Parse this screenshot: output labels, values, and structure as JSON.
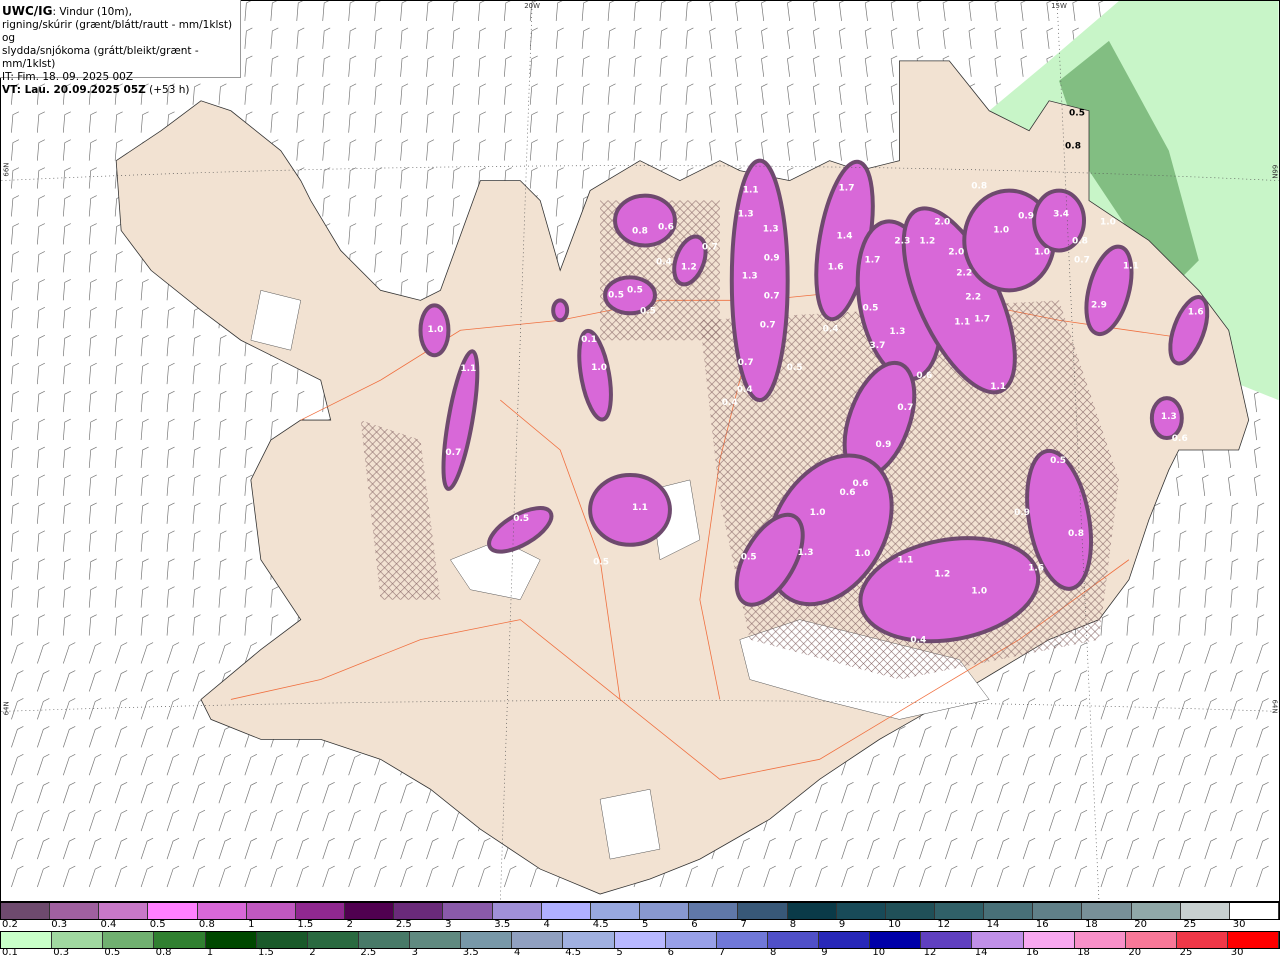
{
  "header": {
    "model": "UWC/IG",
    "line1_rest": ": Vindur (10m),",
    "line2": "rigning/skúrir (grænt/blátt/rautt - mm/1klst) og",
    "line3": "slydda/snjókoma (grátt/bleikt/grænt - mm/1klst)",
    "init_time": "IT: Fim. 18. 09. 2025 00Z",
    "valid_label": "VT: Lau. 20.09.2025 05Z",
    "lead": " (+53 h)"
  },
  "grid_labels": {
    "lon_20w": "20W",
    "lon_15w": "15W",
    "lat_66n_left": "66N",
    "lat_66n_right": "66N",
    "lat_64n_left": "64N",
    "lat_64n_right": "64N"
  },
  "precip_values": [
    "1.0",
    "1.1",
    "0.7",
    "0.5",
    "1.1",
    "0.5",
    "0.1",
    "1.0",
    "0.5",
    "0.5",
    "0.5",
    "0.8",
    "0.6",
    "0.4",
    "1.2",
    "0.7",
    "1.1",
    "1.3",
    "1.3",
    "0.9",
    "1.3",
    "0.7",
    "0.7",
    "0.7",
    "0.4",
    "0.4",
    "0.5",
    "1.7",
    "1.4",
    "1.6",
    "1.7",
    "2.3",
    "1.2",
    "2.0",
    "2.0",
    "2.2",
    "2.2",
    "1.1",
    "1.7",
    "0.4",
    "0.5",
    "1.3",
    "3.7",
    "0.6",
    "0.7",
    "0.9",
    "0.6",
    "0.6",
    "1.0",
    "1.3",
    "1.0",
    "1.1",
    "1.2",
    "1.0",
    "0.4",
    "1.6",
    "0.9",
    "0.5",
    "0.8",
    "0.8",
    "0.9",
    "1.0",
    "1.0",
    "3.4",
    "1.0",
    "0.8",
    "0.7",
    "1.1",
    "2.9",
    "1.6",
    "1.3",
    "0.6",
    "0.5",
    "0.8",
    "0.5",
    "1.1"
  ],
  "snow_scale": {
    "labels": [
      "0.2",
      "0.3",
      "0.4",
      "0.5",
      "0.8",
      "1",
      "1.5",
      "2",
      "2.5",
      "3",
      "3.5",
      "4",
      "4.5",
      "5",
      "6",
      "7",
      "8",
      "9",
      "10",
      "12",
      "14",
      "16",
      "18",
      "20",
      "25",
      "30"
    ],
    "colors": [
      "#6e4a6e",
      "#a060a0",
      "#c878c8",
      "#ff80ff",
      "#d868d8",
      "#c058c0",
      "#902890",
      "#500050",
      "#6a2a7a",
      "#8a5aaa",
      "#a090d8",
      "#b0b0ff",
      "#98a8e0",
      "#8898d0",
      "#6078a8",
      "#385878",
      "#0a3a48",
      "#184a58",
      "#205058",
      "#306068",
      "#487078",
      "#608088",
      "#789098",
      "#90a8a8",
      "#c8d0d0",
      "#ffffff"
    ]
  },
  "rain_scale": {
    "labels": [
      "0.1",
      "0.3",
      "0.5",
      "0.8",
      "1",
      "1.5",
      "2",
      "2.5",
      "3",
      "3.5",
      "4",
      "4.5",
      "5",
      "6",
      "7",
      "8",
      "9",
      "10",
      "12",
      "14",
      "16",
      "18",
      "20",
      "25",
      "30"
    ],
    "colors": [
      "#c8ffc8",
      "#a0d8a0",
      "#70b070",
      "#308030",
      "#004800",
      "#1a5a2a",
      "#2a6a40",
      "#487a68",
      "#608a80",
      "#7898a8",
      "#90a0c0",
      "#a0b0e0",
      "#b8b8ff",
      "#98a0e8",
      "#7078d8",
      "#5050c8",
      "#2828b8",
      "#0000a8",
      "#6040c0",
      "#c090e8",
      "#f8a8f0",
      "#f890c8",
      "#f87898",
      "#f03848",
      "#ff0000"
    ]
  },
  "colors": {
    "land": "#f2e2d2",
    "road": "#f07040",
    "hatch": "#8a6a6a"
  }
}
